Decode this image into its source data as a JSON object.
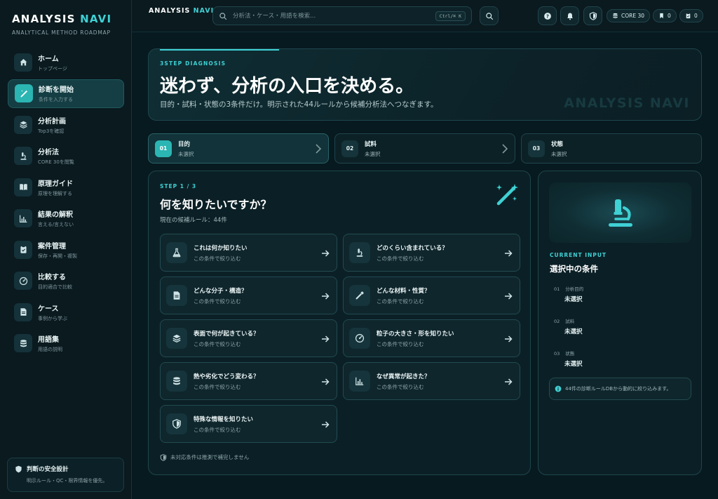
{
  "colors": {
    "accent": "#3fd1d4",
    "accent_fill": "#2bb5b3",
    "bg": "#071a20",
    "panel": "#0b2026"
  },
  "brand": {
    "name": "ANALYSIS",
    "name_accent": "NAVI",
    "subtitle": "ANALYTICAL METHOD ROADMAP"
  },
  "sidebar": {
    "items": [
      {
        "label": "ホーム",
        "sub": "トップページ",
        "icon": "home-icon",
        "active": false
      },
      {
        "label": "診断を開始",
        "sub": "条件を入力する",
        "icon": "wand-icon",
        "active": true
      },
      {
        "label": "分析計画",
        "sub": "Top3を確認",
        "icon": "layers-icon",
        "active": false
      },
      {
        "label": "分析法",
        "sub": "CORE 30を閲覧",
        "icon": "microscope-icon",
        "active": false
      },
      {
        "label": "原理ガイド",
        "sub": "原理を理解する",
        "icon": "book-icon",
        "active": false
      },
      {
        "label": "結果の解釈",
        "sub": "言える/言えない",
        "icon": "chart-icon",
        "active": false
      },
      {
        "label": "案件管理",
        "sub": "保存・再開・複製",
        "icon": "clipboard-icon",
        "active": false
      },
      {
        "label": "比較する",
        "sub": "目的適合で比較",
        "icon": "gauge-icon",
        "active": false
      },
      {
        "label": "ケース",
        "sub": "事例から学ぶ",
        "icon": "document-icon",
        "active": false
      },
      {
        "label": "用語集",
        "sub": "用語の説明",
        "icon": "database-icon",
        "active": false
      }
    ],
    "safety": {
      "title": "判断の安全設計",
      "sub": "明示ルール・QC・限界情報を優先。"
    }
  },
  "topbar": {
    "brand": "ANALYSIS",
    "brand_accent": "NAVI",
    "search_placeholder": "分析法・ケース・用語を検索...",
    "shortcut": "Ctrl/⌘ K",
    "core_label": "CORE 30",
    "bookmark_count": "0",
    "clipboard_count": "0"
  },
  "hero": {
    "kicker": "3STEP DIAGNOSIS",
    "title": "迷わず、分析の入口を決める。",
    "desc": "目的・試料・状態の3条件だけ。明示された44ルールから候補分析法へつなぎます。",
    "watermark": "ANALYSIS NAVI"
  },
  "steps": [
    {
      "num": "01",
      "label": "目的",
      "value": "未選択",
      "active": true
    },
    {
      "num": "02",
      "label": "試料",
      "value": "未選択",
      "active": false
    },
    {
      "num": "03",
      "label": "状態",
      "value": "未選択",
      "active": false
    }
  ],
  "question": {
    "kicker": "STEP 1 / 3",
    "title": "何を知りたいですか？",
    "count": "現在の候補ルール：44件",
    "options": [
      {
        "label": "これは何か知りたい",
        "sub": "この条件で絞り込む",
        "icon": "flask-icon"
      },
      {
        "label": "どのくらい含まれている？",
        "sub": "この条件で絞り込む",
        "icon": "microscope-icon"
      },
      {
        "label": "どんな分子・構造？",
        "sub": "この条件で絞り込む",
        "icon": "document-icon"
      },
      {
        "label": "どんな材料・性質？",
        "sub": "この条件で絞り込む",
        "icon": "pipette-icon"
      },
      {
        "label": "表面で何が起きている？",
        "sub": "この条件で絞り込む",
        "icon": "layers-icon"
      },
      {
        "label": "粒子の大きさ・形を知りたい",
        "sub": "この条件で絞り込む",
        "icon": "gauge-icon"
      },
      {
        "label": "熱や劣化でどう変わる？",
        "sub": "この条件で絞り込む",
        "icon": "database-icon"
      },
      {
        "label": "なぜ異常が起きた？",
        "sub": "この条件で絞り込む",
        "icon": "chart-icon"
      },
      {
        "label": "特殊な情報を知りたい",
        "sub": "この条件で絞り込む",
        "icon": "shield-icon"
      }
    ],
    "footnote": "未対応条件は推測で補完しません"
  },
  "current": {
    "kicker": "CURRENT INPUT",
    "title": "選択中の条件",
    "conditions": [
      {
        "num": "01",
        "label": "分析目的",
        "value": "未選択"
      },
      {
        "num": "02",
        "label": "試料",
        "value": "未選択"
      },
      {
        "num": "03",
        "label": "状態",
        "value": "未選択"
      }
    ],
    "note": "44件の診断ルールDBから動的に絞り込みます。"
  }
}
